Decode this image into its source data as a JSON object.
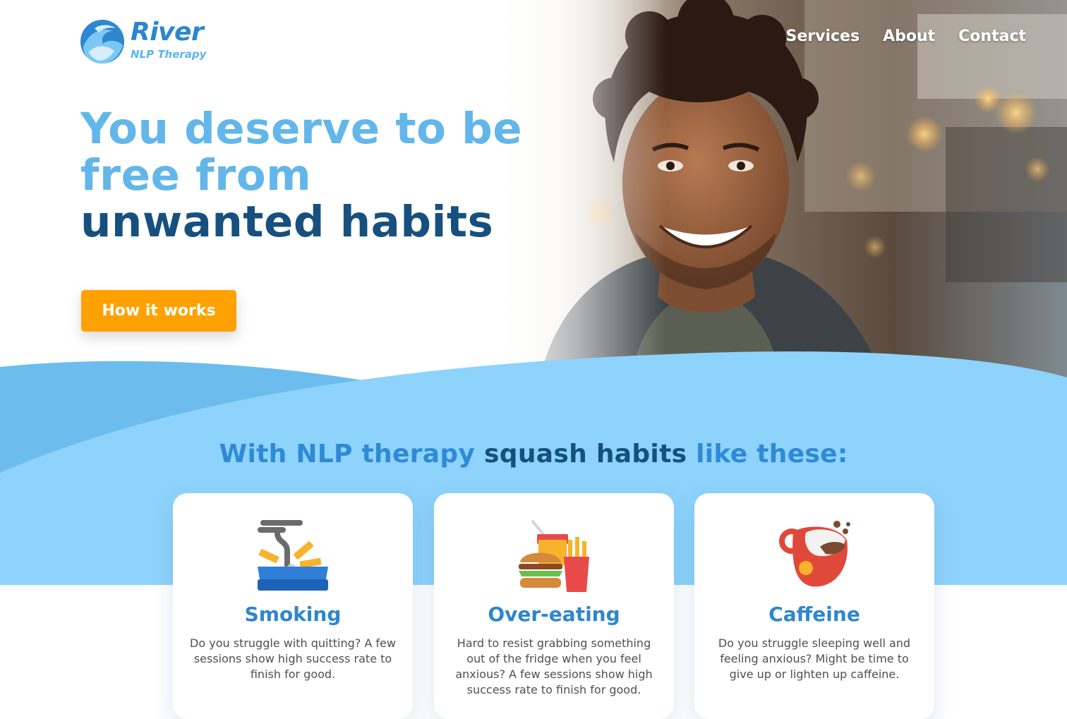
{
  "brand": {
    "name": "River",
    "tagline": "NLP Therapy"
  },
  "nav": {
    "items": [
      "Services",
      "About",
      "Contact"
    ]
  },
  "hero": {
    "line1": "You deserve to be",
    "line2": "free from",
    "line3": "unwanted habits",
    "cta_label": "How it works"
  },
  "habits_section": {
    "title_part1": "With NLP therapy",
    "title_part2": "squash habits",
    "title_part3": "like these:",
    "cards": [
      {
        "title": "Smoking",
        "text": "Do you struggle with quitting? A few sessions show high success rate to finish for good.",
        "icon": "ashtray-icon"
      },
      {
        "title": "Over-eating",
        "text": "Hard to resist grabbing something out of the fridge when you feel anxious?  A few sessions show high success rate to finish for good.",
        "icon": "fast-food-icon"
      },
      {
        "title": "Caffeine",
        "text": "Do you struggle sleeping well and feeling anxious? Might be time to give up or lighten up caffeine.",
        "icon": "coffee-cup-icon"
      }
    ]
  },
  "colors": {
    "accent_orange": "#ffa100",
    "light_blue": "#62b6ea",
    "dark_blue": "#17507e",
    "wave_blue": "#8dd3fb"
  }
}
